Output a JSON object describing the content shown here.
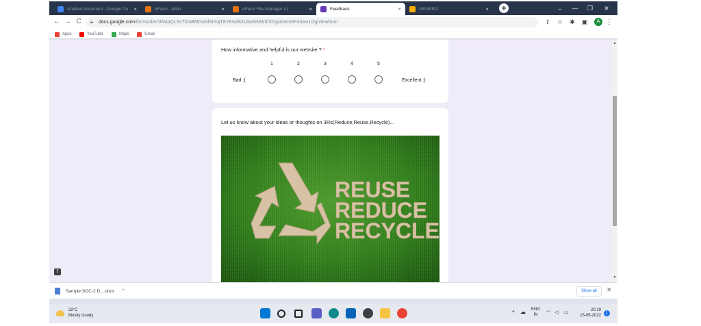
{
  "tabs": [
    {
      "label": "Untitled document - Google Do",
      "favicon_color": "#4285f4"
    },
    {
      "label": "eFarm - Main",
      "favicon_color": "#e8710a"
    },
    {
      "label": "eFarm File Manager v1",
      "favicon_color": "#e8710a"
    },
    {
      "label": "Feedback",
      "favicon_color": "#673ab7",
      "active": true
    },
    {
      "label": "GENERO",
      "favicon_color": "#f9ab00"
    }
  ],
  "tab_close_glyph": "×",
  "new_tab_glyph": "+",
  "window_controls": {
    "menu": "⌄",
    "minimize": "—",
    "maximize": "❐",
    "close": "✕"
  },
  "toolbar": {
    "back_icon": "←",
    "forward_icon": "→",
    "reload_icon": "C",
    "url_host": "docs.google.com",
    "url_path": "/forms/d/e/1FAIpQLScTi2uBMOaSlSiXojT8YKNdKkUbaNNNrhfXDgukSmGF4nwo1Og/viewform",
    "profile_initial": "A"
  },
  "bookmarks": [
    {
      "label": "Apps",
      "color": "#ea4335"
    },
    {
      "label": "YouTube",
      "color": "#ff0000"
    },
    {
      "label": "Maps",
      "color": "#34a853"
    },
    {
      "label": "Gmail",
      "color": "#ea4335"
    }
  ],
  "form": {
    "question1": {
      "title": "How informative and helpful is our website ?",
      "required_mark": "*",
      "scale": [
        "1",
        "2",
        "3",
        "4",
        "5"
      ],
      "low_label": "Bad :(",
      "high_label": "Excellent :)"
    },
    "question2": {
      "title": "Let us know about your ideas or thoughts on 3Rs(Reduce,Reuse,Recycle)...",
      "image_text": [
        "REUSE",
        "REDUCE",
        "RECYCLE"
      ]
    }
  },
  "downloads": {
    "file": "Sample SOC-2 D....docx",
    "show_all": "Show all",
    "close_glyph": "✕"
  },
  "taskbar": {
    "temperature": "32°C",
    "weather": "Mostly cloudy",
    "language": "ENG",
    "region": "IN",
    "time": "20:19",
    "date": "15-05-2022",
    "notification_count": "1",
    "apps": [
      {
        "name": "start",
        "color": "#0078d4"
      },
      {
        "name": "search",
        "color": "#1f1f1f"
      },
      {
        "name": "task-view",
        "color": "#1f1f1f"
      },
      {
        "name": "chat",
        "color": "#5b5fc7"
      },
      {
        "name": "edge",
        "color": "#0f8a8a"
      },
      {
        "name": "mail",
        "color": "#0a64b8"
      },
      {
        "name": "media",
        "color": "#3c4043"
      },
      {
        "name": "file-explorer",
        "color": "#f6c342"
      },
      {
        "name": "chrome",
        "color": "#ea4335"
      }
    ]
  }
}
